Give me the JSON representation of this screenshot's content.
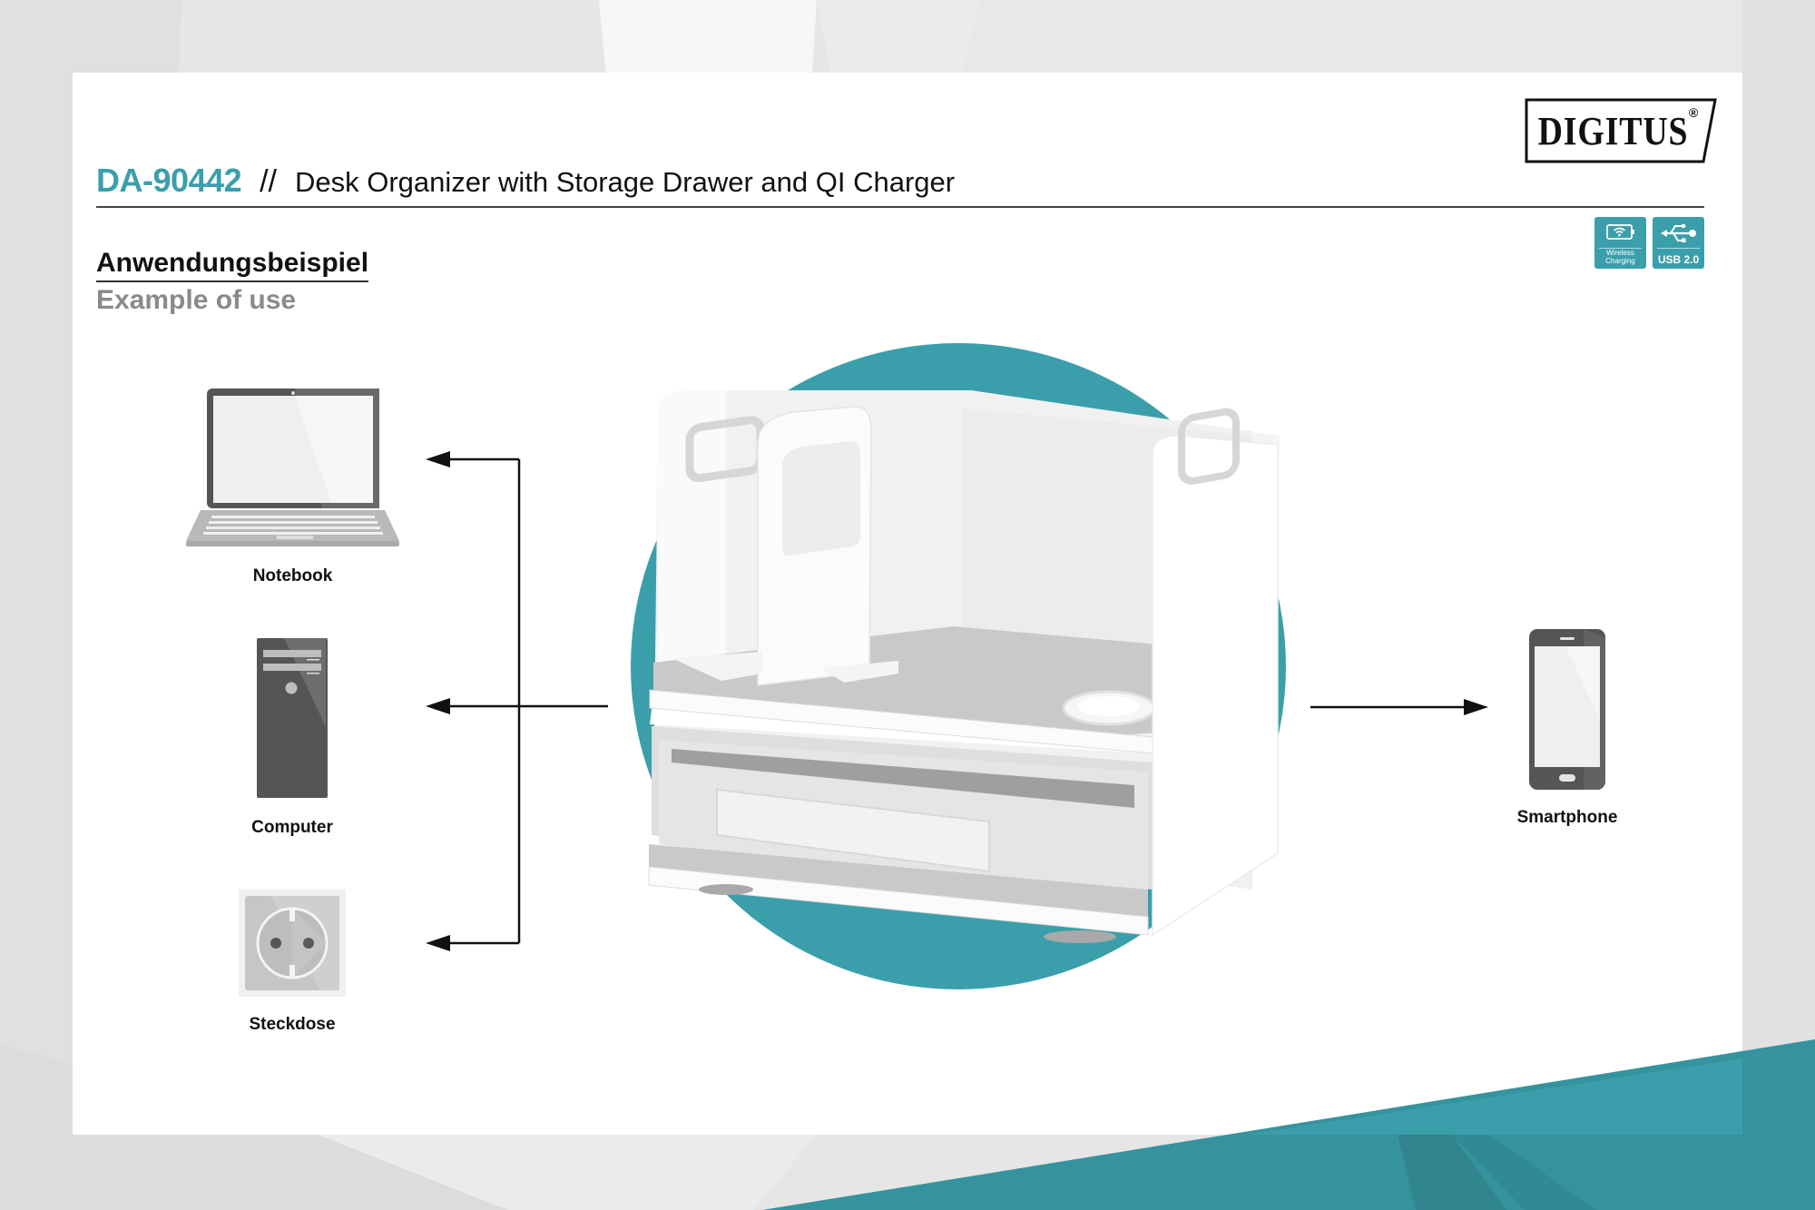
{
  "brand": {
    "logo_text": "DIGITUS",
    "registered_mark": "®",
    "accent_color": "#3a9fab"
  },
  "header": {
    "product_code": "DA-90442",
    "separator": "//",
    "product_name": "Desk Organizer with Storage Drawer and QI Charger"
  },
  "badges": [
    {
      "icon": "wireless-charging-icon",
      "label_line1": "Wireless",
      "label_line2": "Charging"
    },
    {
      "icon": "usb-icon",
      "label": "USB 2.0"
    }
  ],
  "section": {
    "heading": "Anwendungsbeispiel",
    "subheading": "Example of use"
  },
  "devices": {
    "notebook": {
      "icon": "laptop-icon",
      "label": "Notebook"
    },
    "computer": {
      "icon": "desktop-tower-icon",
      "label": "Computer"
    },
    "socket": {
      "icon": "power-socket-icon",
      "label": "Steckdose"
    },
    "smartphone": {
      "icon": "smartphone-icon",
      "label": "Smartphone"
    }
  },
  "product_image": {
    "subject": "desk-organizer-product"
  },
  "colors": {
    "teal": "#3a9fab",
    "teal_dark": "#35939e",
    "device_gray": "#555555"
  }
}
